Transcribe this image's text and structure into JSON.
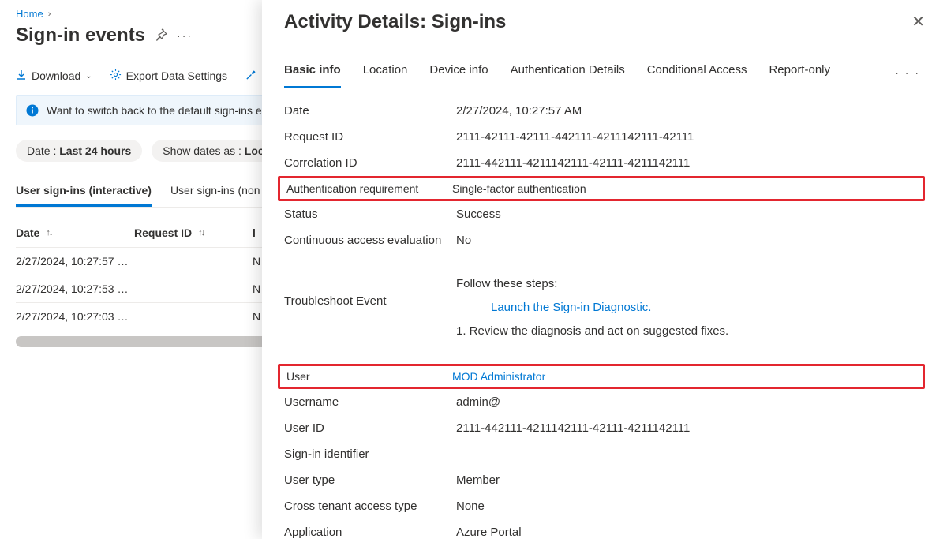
{
  "breadcrumb": {
    "home": "Home"
  },
  "page": {
    "title": "Sign-in events",
    "toolbar": {
      "download": "Download",
      "export_settings": "Export Data Settings"
    },
    "infobar": "Want to switch back to the default sign-ins experi",
    "filters": {
      "date_prefix": "Date :",
      "date_value": "Last 24 hours",
      "show_prefix": "Show dates as :",
      "show_value": "Loca"
    },
    "subtabs": {
      "interactive": "User sign-ins (interactive)",
      "noninteractive": "User sign-ins (non"
    },
    "columns": {
      "date": "Date",
      "request_id": "Request ID"
    },
    "rows": [
      {
        "date": "2/27/2024, 10:27:57 …",
        "tail": "N"
      },
      {
        "date": "2/27/2024, 10:27:53 …",
        "tail": "N"
      },
      {
        "date": "2/27/2024, 10:27:03 …",
        "tail": "N"
      }
    ]
  },
  "panel": {
    "title": "Activity Details: Sign-ins",
    "tabs": {
      "basic": "Basic info",
      "location": "Location",
      "device": "Device info",
      "auth": "Authentication Details",
      "ca": "Conditional Access",
      "report": "Report-only"
    },
    "fields": {
      "date_label": "Date",
      "date_value": "2/27/2024, 10:27:57 AM",
      "request_id_label": "Request ID",
      "request_id_value": "2111-42111-42111-442111-4211142111-42111",
      "correlation_id_label": "Correlation ID",
      "correlation_id_value": "2111-442111-4211142111-42111-4211142111",
      "auth_req_label": "Authentication requirement",
      "auth_req_value": "Single-factor authentication",
      "status_label": "Status",
      "status_value": "Success",
      "cae_label": "Continuous access evaluation",
      "cae_value": "No",
      "troubleshoot_label": "Troubleshoot Event",
      "troubleshoot_steps": "Follow these steps:",
      "troubleshoot_link": "Launch the Sign-in Diagnostic.",
      "troubleshoot_review": "1. Review the diagnosis and act on suggested fixes.",
      "user_label": "User",
      "user_value": "MOD Administrator",
      "username_label": "Username",
      "username_value": "admin@",
      "user_id_label": "User ID",
      "user_id_value": "2111-442111-4211142111-42111-4211142111",
      "signin_identifier_label": "Sign-in identifier",
      "signin_identifier_value": "",
      "user_type_label": "User type",
      "user_type_value": "Member",
      "cross_tenant_label": "Cross tenant access type",
      "cross_tenant_value": "None",
      "application_label": "Application",
      "application_value": "Azure Portal"
    }
  }
}
